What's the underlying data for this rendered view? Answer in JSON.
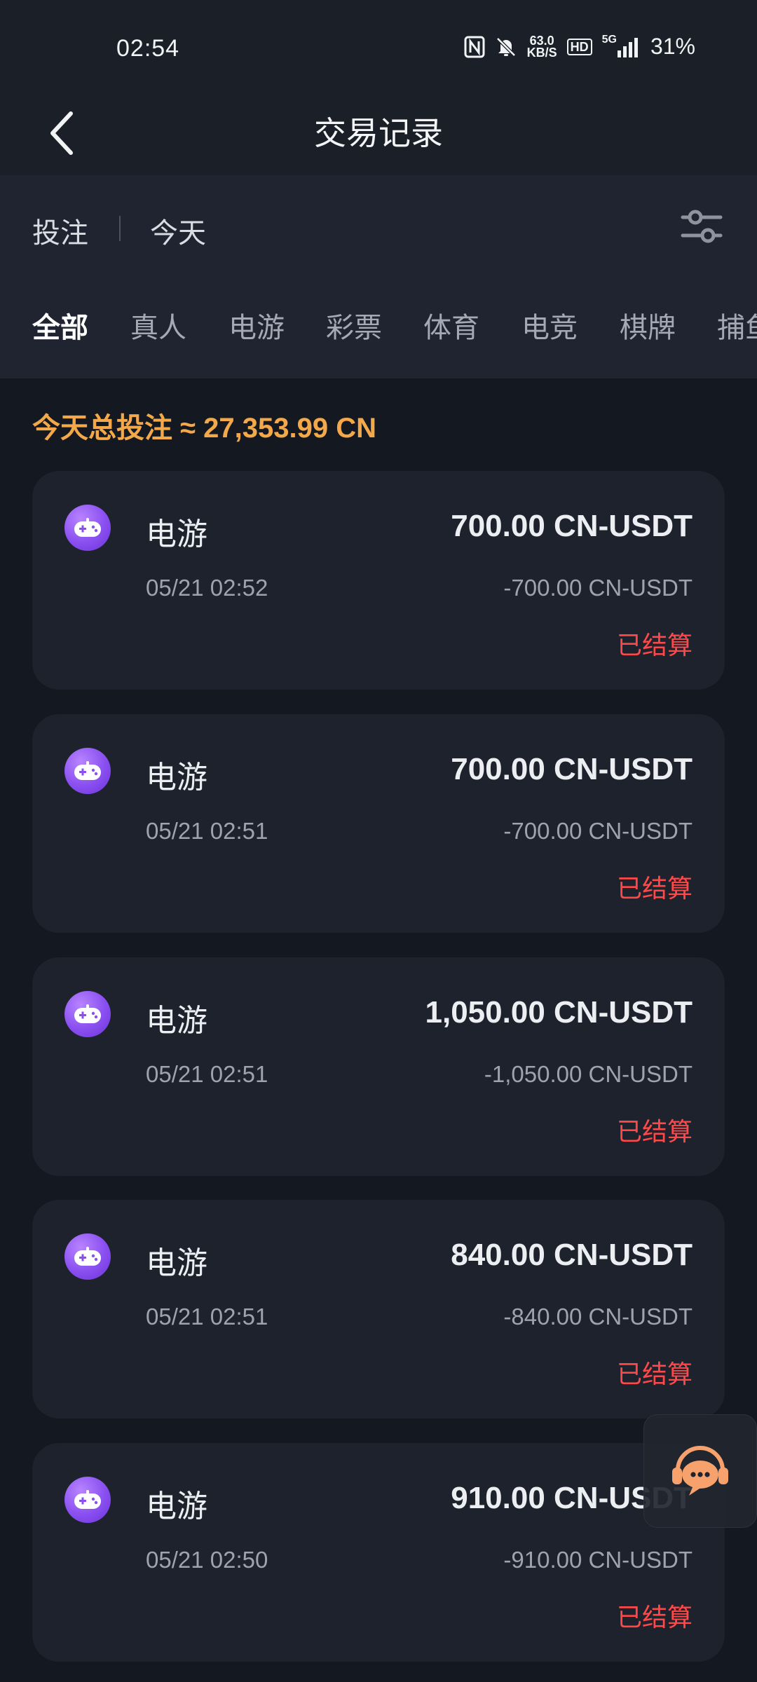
{
  "status_bar": {
    "time": "02:54",
    "speed_value": "63.0",
    "speed_unit": "KB/S",
    "hd": "HD",
    "network": "5G",
    "battery": "31%"
  },
  "header": {
    "title": "交易记录"
  },
  "filter": {
    "type_label": "投注",
    "date_label": "今天"
  },
  "tabs": [
    {
      "label": "全部",
      "active": true
    },
    {
      "label": "真人"
    },
    {
      "label": "电游"
    },
    {
      "label": "彩票"
    },
    {
      "label": "体育"
    },
    {
      "label": "电竞"
    },
    {
      "label": "棋牌"
    },
    {
      "label": "捕鱼"
    }
  ],
  "summary": {
    "text": "今天总投注 ≈ 27,353.99 CN"
  },
  "records": [
    {
      "category": "电游",
      "amount": "700.00 CN-USDT",
      "time": "05/21 02:52",
      "profit": "-700.00 CN-USDT",
      "status": "已结算"
    },
    {
      "category": "电游",
      "amount": "700.00 CN-USDT",
      "time": "05/21 02:51",
      "profit": "-700.00 CN-USDT",
      "status": "已结算"
    },
    {
      "category": "电游",
      "amount": "1,050.00 CN-USDT",
      "time": "05/21 02:51",
      "profit": "-1,050.00 CN-USDT",
      "status": "已结算"
    },
    {
      "category": "电游",
      "amount": "840.00 CN-USDT",
      "time": "05/21 02:51",
      "profit": "-840.00 CN-USDT",
      "status": "已结算"
    },
    {
      "category": "电游",
      "amount": "910.00 CN-USDT",
      "time": "05/21 02:50",
      "profit": "-910.00 CN-USDT",
      "status": "已结算"
    }
  ],
  "colors": {
    "background": "#141821",
    "card": "#1d222d",
    "accent_orange": "#f3a84a",
    "status_red": "#ff4949",
    "icon_purple": "#8a4ff0",
    "support_orange": "#f7a26c"
  },
  "icons": {
    "back": "chevron-left-icon",
    "filter": "sliders-icon",
    "category": "gamepad-icon",
    "support": "customer-service-icon"
  }
}
